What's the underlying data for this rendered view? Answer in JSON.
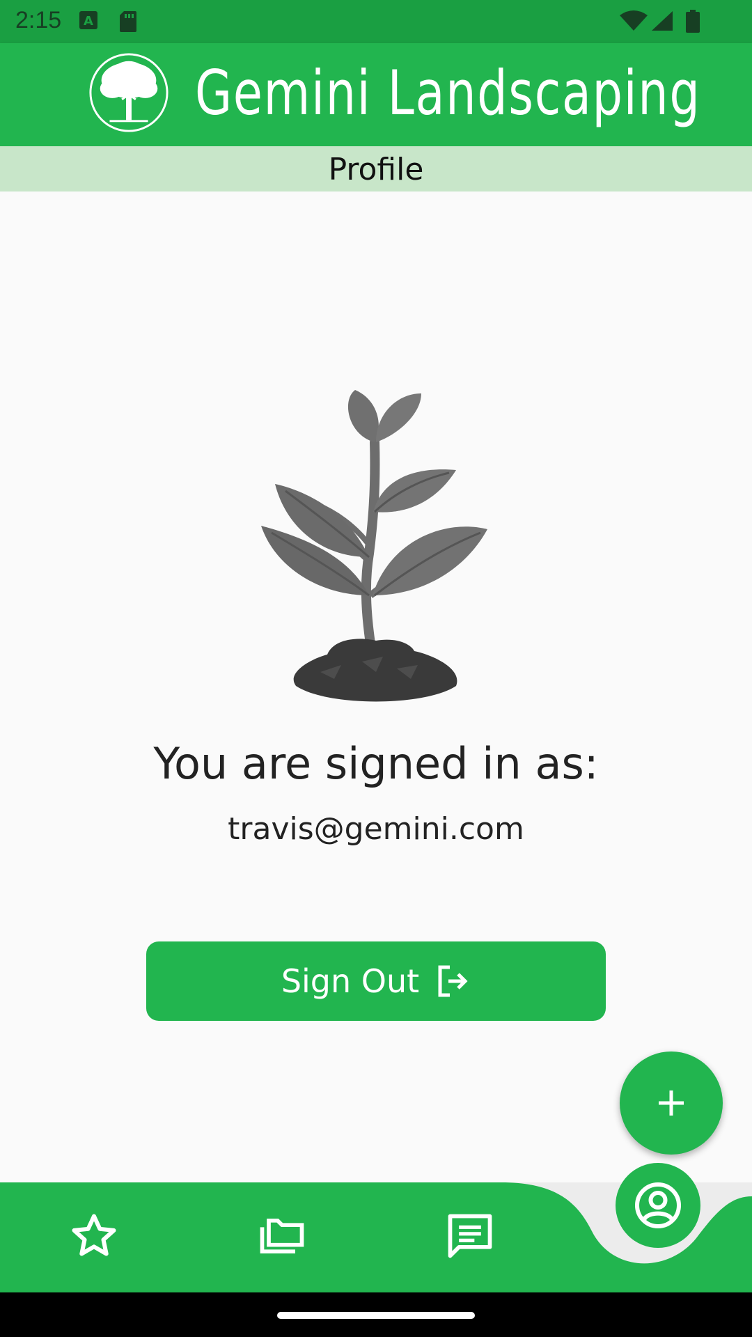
{
  "status_bar": {
    "time": "2:15",
    "icons": [
      "text-a-icon",
      "sd-card-icon",
      "wifi-icon",
      "signal-icon",
      "battery-icon"
    ]
  },
  "app_bar": {
    "title": "Gemini Landscaping",
    "logo_icon": "tree-logo-icon",
    "color": "#22b54f"
  },
  "page_header": {
    "title": "Profile",
    "color": "#c8e6c9"
  },
  "profile": {
    "illustration": "plant-sprout-icon",
    "signed_in_label": "You are signed in as:",
    "email": "travis@gemini.com",
    "sign_out_label": "Sign Out",
    "sign_out_icon": "logout-icon"
  },
  "fab": {
    "icon": "plus-icon"
  },
  "bottom_nav": {
    "items": [
      {
        "icon": "star-icon"
      },
      {
        "icon": "folders-icon"
      },
      {
        "icon": "chat-icon"
      },
      {
        "icon": "account-circle-icon",
        "selected": true
      }
    ]
  }
}
